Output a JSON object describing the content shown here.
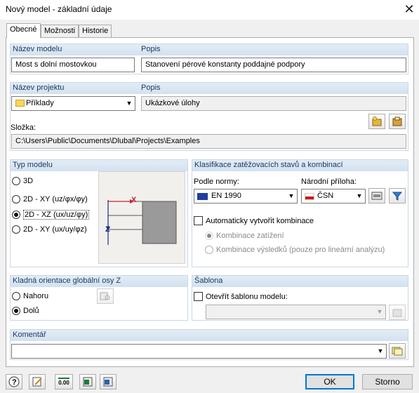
{
  "window": {
    "title": "Nový model - základní údaje"
  },
  "tabs": [
    {
      "label": "Obecné"
    },
    {
      "label": "Možnosti"
    },
    {
      "label": "Historie"
    }
  ],
  "model": {
    "name_label": "Název modelu",
    "name_value": "Most s dolní mostovkou",
    "desc_label": "Popis",
    "desc_value": "Stanovení pérové konstanty poddajné podpory"
  },
  "project": {
    "name_label": "Název projektu",
    "name_value": "Příklady",
    "desc_label": "Popis",
    "desc_value": "Ukázkové úlohy",
    "folder_label": "Složka:",
    "folder_value": "C:\\Users\\Public\\Documents\\Dlubal\\Projects\\Examples"
  },
  "model_type": {
    "header": "Typ modelu",
    "options": [
      {
        "label": "3D",
        "selected": false
      },
      {
        "label": "2D - XY (uz/φx/φy)",
        "selected": false
      },
      {
        "label": "2D - XZ (ux/uz/φy)",
        "selected": true
      },
      {
        "label": "2D - XY (ux/uy/φz)",
        "selected": false
      }
    ],
    "preview": {
      "axis_x": "X",
      "axis_z": "Z"
    }
  },
  "classification": {
    "header": "Klasifikace zatěžovacích stavů a kombinací",
    "norm_label": "Podle normy:",
    "norm_value": "EN 1990",
    "annex_label": "Národní příloha:",
    "annex_value": "ČSN",
    "auto_label": "Automaticky vytvořit kombinace",
    "combo_loads": "Kombinace zatížení",
    "combo_results": "Kombinace výsledků (pouze pro lineární analýzu)"
  },
  "orientation": {
    "header": "Kladná orientace globální osy Z",
    "options": [
      {
        "label": "Nahoru",
        "selected": false
      },
      {
        "label": "Dolů",
        "selected": true
      }
    ]
  },
  "template": {
    "header": "Šablona",
    "open_label": "Otevřít šablonu modelu:",
    "value": ""
  },
  "comment": {
    "header": "Komentář",
    "value": ""
  },
  "footer": {
    "ok": "OK",
    "cancel": "Storno",
    "units": "0.00"
  },
  "colors": {
    "accent": "#0078d7",
    "section_header": "#d9e5f1",
    "preview_bg": "#f2f0ed",
    "axis_red": "#d0202a",
    "axis_blue": "#1b2a88"
  }
}
